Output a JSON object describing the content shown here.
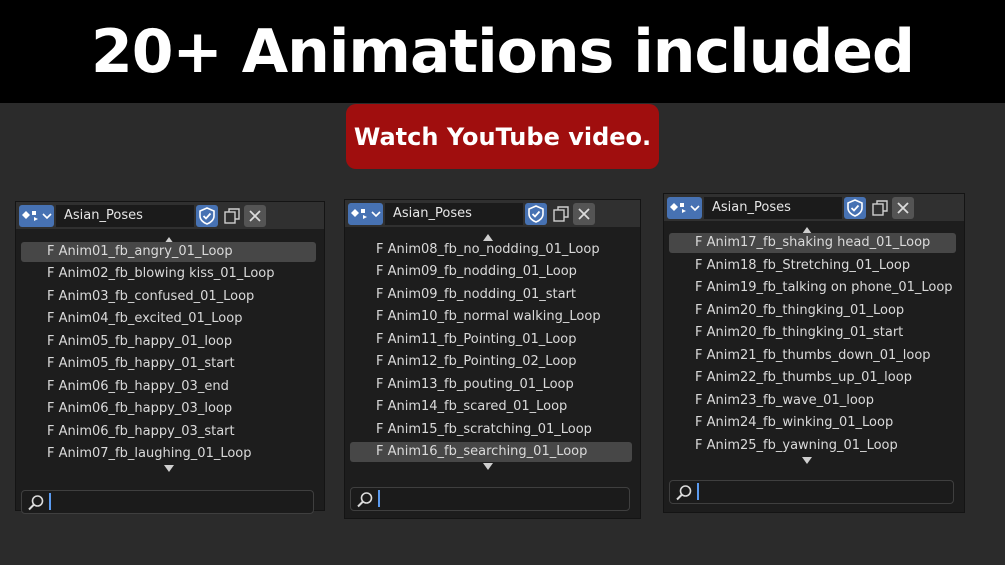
{
  "banner": {
    "title": "20+ Animations included"
  },
  "video_button": {
    "label": "Watch YouTube video."
  },
  "panels": [
    {
      "action_name": "Asian_Poses",
      "items": [
        "F Anim01_fb_angry_01_Loop",
        "F Anim02_fb_blowing kiss_01_Loop",
        "F Anim03_fb_confused_01_Loop",
        "F Anim04_fb_excited_01_Loop",
        "F Anim05_fb_happy_01_loop",
        "F Anim05_fb_happy_01_start",
        "F Anim06_fb_happy_03_end",
        "F Anim06_fb_happy_03_loop",
        "F Anim06_fb_happy_03_start",
        "F Anim07_fb_laughing_01_Loop"
      ],
      "selected_index": 0,
      "search_value": ""
    },
    {
      "action_name": "Asian_Poses",
      "items": [
        "F Anim08_fb_no_nodding_01_Loop",
        "F Anim09_fb_nodding_01_Loop",
        "F Anim09_fb_nodding_01_start",
        "F Anim10_fb_normal walking_Loop",
        "F Anim11_fb_Pointing_01_Loop",
        "F Anim12_fb_Pointing_02_Loop",
        "F Anim13_fb_pouting_01_Loop",
        "F Anim14_fb_scared_01_Loop",
        "F Anim15_fb_scratching_01_Loop",
        "F Anim16_fb_searching_01_Loop"
      ],
      "selected_index": 9,
      "search_value": ""
    },
    {
      "action_name": "Asian_Poses",
      "items": [
        "F Anim17_fb_shaking head_01_Loop",
        "F Anim18_fb_Stretching_01_Loop",
        "F Anim19_fb_talking on phone_01_Loop",
        "F Anim20_fb_thingking_01_Loop",
        "F Anim20_fb_thingking_01_start",
        "F Anim21_fb_thumbs_down_01_loop",
        "F Anim22_fb_thumbs_up_01_loop",
        "F Anim23_fb_wave_01_loop",
        "F Anim24_fb_winking_01_Loop",
        "F Anim25_fb_yawning_01_Loop"
      ],
      "selected_index": 0,
      "search_value": ""
    }
  ],
  "colors": {
    "accent": "#4772b3",
    "video_button": "#a00e0e",
    "selection": "#474747"
  },
  "icons": [
    "action-icon",
    "chevron-down-icon",
    "fake-user-shield-icon",
    "duplicate-icon",
    "close-icon",
    "search-icon",
    "scroll-up-icon",
    "scroll-down-icon"
  ]
}
